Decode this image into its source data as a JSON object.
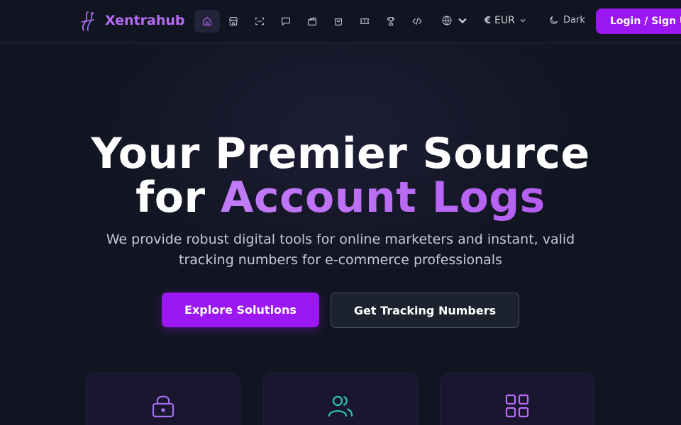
{
  "brand": {
    "name": "Xentrahub",
    "color": "#b66cf5"
  },
  "nav": {
    "icons": [
      "home-icon",
      "store-icon",
      "scan-icon",
      "chat-icon",
      "clapperboard-icon",
      "shopping-bag-icon",
      "ticket-icon",
      "trophy-icon",
      "code-icon"
    ],
    "active": "home-icon"
  },
  "header": {
    "language_icon": "globe-icon",
    "currency_symbol": "€",
    "currency": "EUR",
    "theme_label": "Dark",
    "login_label": "Login / Sign Up"
  },
  "hero": {
    "title_line1": "Your Premier Source",
    "title_line2_prefix": "for ",
    "title_line2_accent": "Account Logs",
    "subtitle": "We provide robust digital tools for online marketers and instant, valid tracking numbers for e-commerce professionals",
    "primary_button": "Explore Solutions",
    "secondary_button": "Get Tracking Numbers"
  },
  "features": [
    {
      "icon": "lock-icon",
      "color": "#a070f2"
    },
    {
      "icon": "users-icon",
      "color": "#2ec4b6"
    },
    {
      "icon": "grid-icon",
      "color": "#b66cf5"
    }
  ],
  "colors": {
    "accent": "#9b18f2",
    "background": "#111521"
  }
}
